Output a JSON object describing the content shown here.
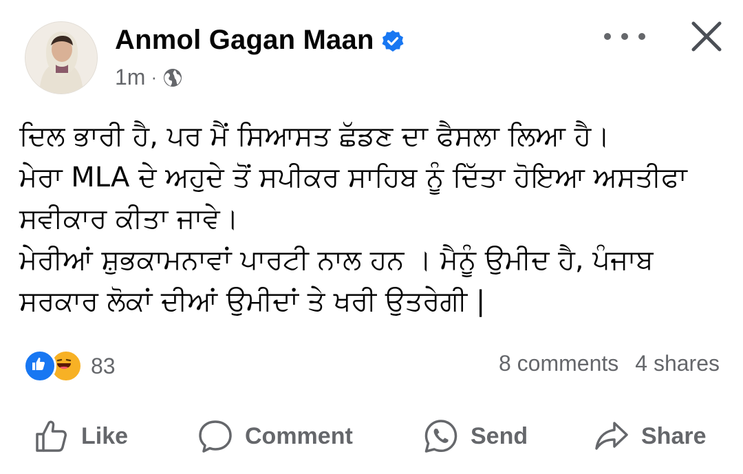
{
  "post": {
    "author": "Anmol Gagan Maan",
    "time": "1m",
    "separator": "·",
    "lines": [
      "ਦਿਲ ਭਾਰੀ ਹੈ, ਪਰ ਮੈਂ ਸਿਆਸਤ ਛੱਡਣ ਦਾ ਫੈਸਲਾ ਲਿਆ ਹੈ।",
      "ਮੇਰਾ MLA ਦੇ ਅਹੁਦੇ ਤੋਂ ਸਪੀਕਰ ਸਾਹਿਬ ਨੂੰ ਦਿੱਤਾ ਹੋਇਆ ਅਸਤੀਫਾ",
      "ਸਵੀਕਾਰ ਕੀਤਾ ਜਾਵੇ।",
      "ਮੇਰੀਆਂ ਸ਼ੁਭਕਾਮਨਾਵਾਂ ਪਾਰਟੀ ਨਾਲ ਹਨ । ਮੈਨੂੰ ਉਮੀਦ ਹੈ,  ਪੰਜਾਬ",
      "ਸਰਕਾਰ ਲੋਕਾਂ ਦੀਆਂ ਉਮੀਦਾਂ ਤੇ ਖਰੀ ਉਤਰੇਗੀ |"
    ]
  },
  "icons": {
    "verified": "verified-badge-icon",
    "audience": "globe-icon",
    "more": "more-options-icon",
    "close": "close-icon"
  },
  "stats": {
    "reaction_count": "83",
    "comments": "8 comments",
    "shares": "4 shares"
  },
  "actions": {
    "like": "Like",
    "comment": "Comment",
    "send": "Send",
    "share": "Share"
  },
  "colors": {
    "brand_blue": "#1877f2",
    "secondary_text": "#65676b",
    "primary_text": "#050505"
  }
}
